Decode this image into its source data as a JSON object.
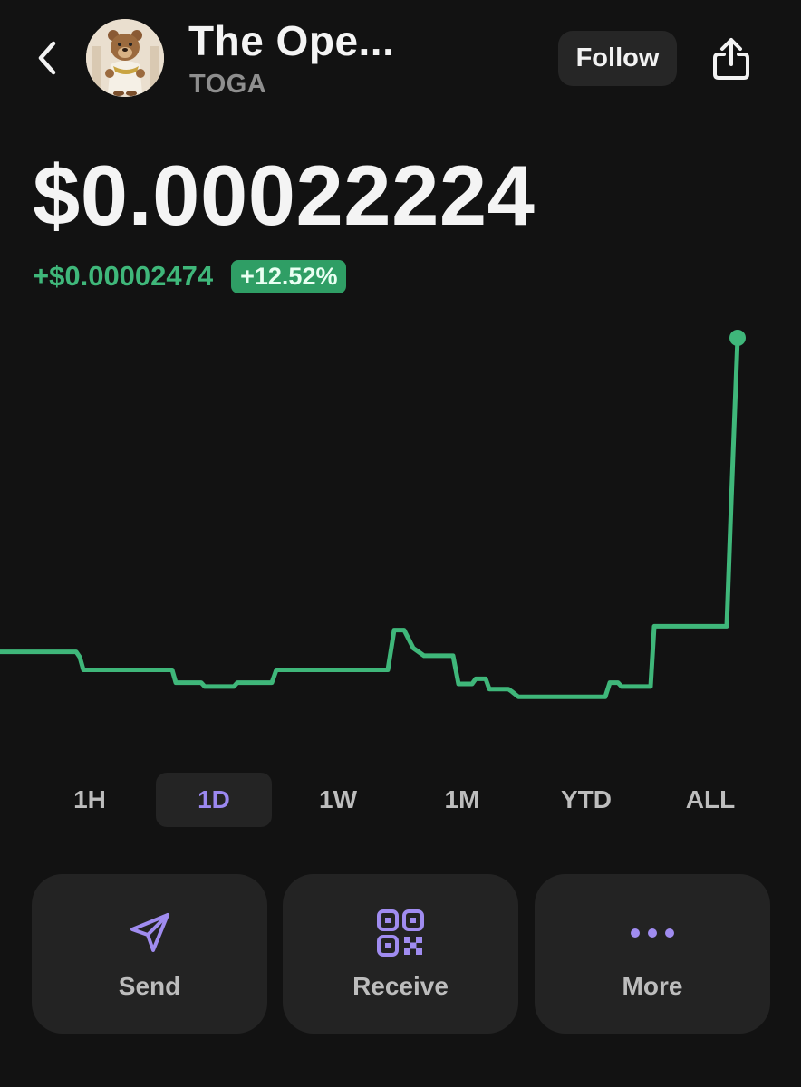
{
  "header": {
    "token_name": "The Ope...",
    "token_symbol": "TOGA",
    "follow_label": "Follow",
    "back_icon": "chevron-left-icon",
    "share_icon": "share-icon"
  },
  "price": {
    "current": "$0.00022224",
    "change_abs": "+$0.00002474",
    "change_pct": "+12.52%"
  },
  "colors": {
    "positive": "#3fb77a",
    "accent": "#9b88f0",
    "background": "#121212"
  },
  "chart_data": {
    "type": "line",
    "period": "1D",
    "series": [
      {
        "values": [
          0.0001977,
          0.0001977,
          0.0001973,
          0.0001963,
          0.0001963,
          0.0001953,
          0.000195,
          0.000195,
          0.0001953,
          0.0001953,
          0.0001963,
          0.0001963,
          0.0001994,
          0.0001994,
          0.000198,
          0.0001974,
          0.0001974,
          0.0001952,
          0.0001956,
          0.0001948,
          0.0001946,
          0.0001942,
          0.0001942,
          0.0001953,
          0.000195,
          0.0001997,
          0.0001997,
          0.0002094,
          0.0002222
        ]
      }
    ]
  },
  "ranges": {
    "items": [
      {
        "label": "1H"
      },
      {
        "label": "1D"
      },
      {
        "label": "1W"
      },
      {
        "label": "1M"
      },
      {
        "label": "YTD"
      },
      {
        "label": "ALL"
      }
    ],
    "selected": "1D"
  },
  "actions": {
    "send": {
      "label": "Send",
      "icon": "send-icon"
    },
    "receive": {
      "label": "Receive",
      "icon": "qr-code-icon"
    },
    "more": {
      "label": "More",
      "icon": "more-dots-icon"
    }
  }
}
